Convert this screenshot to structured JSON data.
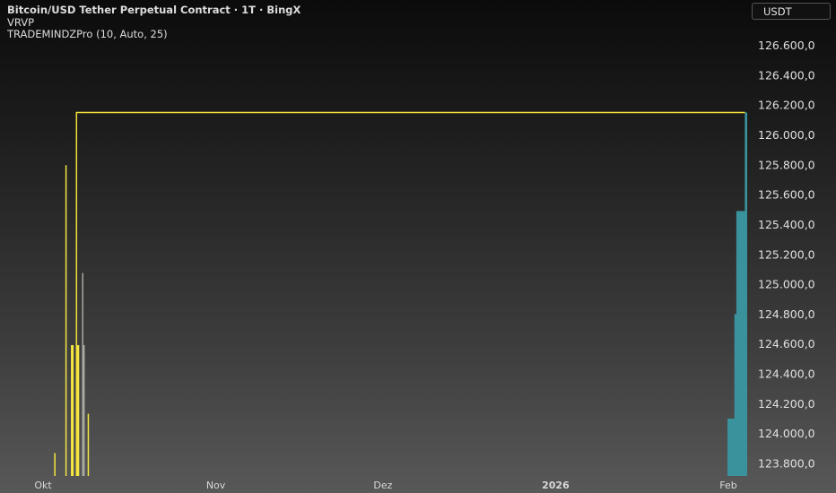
{
  "header": {
    "title": "Bitcoin/USD Tether Perpetual Contract · 1T · BingX",
    "indicator1": "VRVP",
    "indicator2": "TRADEMINDZPro (10, Auto, 25)"
  },
  "currency_button": "USDT",
  "colors": {
    "line": "#f2e03a",
    "volume_up": "#f5e642",
    "volume_neutral": "#a8a8a0",
    "vrvp": "#3a939c"
  },
  "chart_data": {
    "type": "line",
    "y_axis": {
      "range": [
        123700,
        126700
      ],
      "ticks": [
        "126.600,0",
        "126.400,0",
        "126.200,0",
        "126.000,0",
        "125.800,0",
        "125.600,0",
        "125.400,0",
        "125.200,0",
        "125.000,0",
        "124.800,0",
        "124.600,0",
        "124.400,0",
        "124.200,0",
        "124.000,0",
        "123.800,0"
      ],
      "tick_values": [
        126600,
        126400,
        126200,
        126000,
        125800,
        125600,
        125400,
        125200,
        125000,
        124800,
        124600,
        124400,
        124200,
        124000,
        123800
      ]
    },
    "x_axis": {
      "range": [
        "2025-09-30",
        "2026-02-05"
      ],
      "ticks": [
        {
          "label": "Okt",
          "date": "2025-10-01",
          "bold": false
        },
        {
          "label": "Nov",
          "date": "2025-11-01",
          "bold": false
        },
        {
          "label": "Dez",
          "date": "2025-12-01",
          "bold": false
        },
        {
          "label": "2026",
          "date": "2026-01-01",
          "bold": true
        },
        {
          "label": "Feb",
          "date": "2026-02-01",
          "bold": false
        }
      ]
    },
    "series": [
      {
        "points": [
          {
            "date": "2025-10-07",
            "value": 123700
          },
          {
            "date": "2025-10-07",
            "value": 126150
          },
          {
            "date": "2026-02-04",
            "value": 126150
          }
        ]
      }
    ],
    "volume_bars": [
      {
        "date": "2025-10-03",
        "level": 0.07,
        "kind": "up"
      },
      {
        "date": "2025-10-05",
        "level": 0.95,
        "kind": "up"
      },
      {
        "date": "2025-10-06",
        "level": 0.4,
        "kind": "up"
      },
      {
        "date": "2025-10-07",
        "level": 0.4,
        "kind": "up"
      },
      {
        "date": "2025-10-08",
        "level": 0.4,
        "kind": "neutral"
      },
      {
        "date": "2025-10-08",
        "level": 0.62,
        "kind": "neutral"
      },
      {
        "date": "2025-10-09",
        "level": 0.19,
        "kind": "up"
      }
    ],
    "vrvp_profile": [
      {
        "from": 123700,
        "to": 124100,
        "level": 1.0
      },
      {
        "from": 124100,
        "to": 124800,
        "level": 0.65
      },
      {
        "from": 124800,
        "to": 125490,
        "level": 0.55
      },
      {
        "from": 125490,
        "to": 126150,
        "level": 0.12
      }
    ]
  }
}
